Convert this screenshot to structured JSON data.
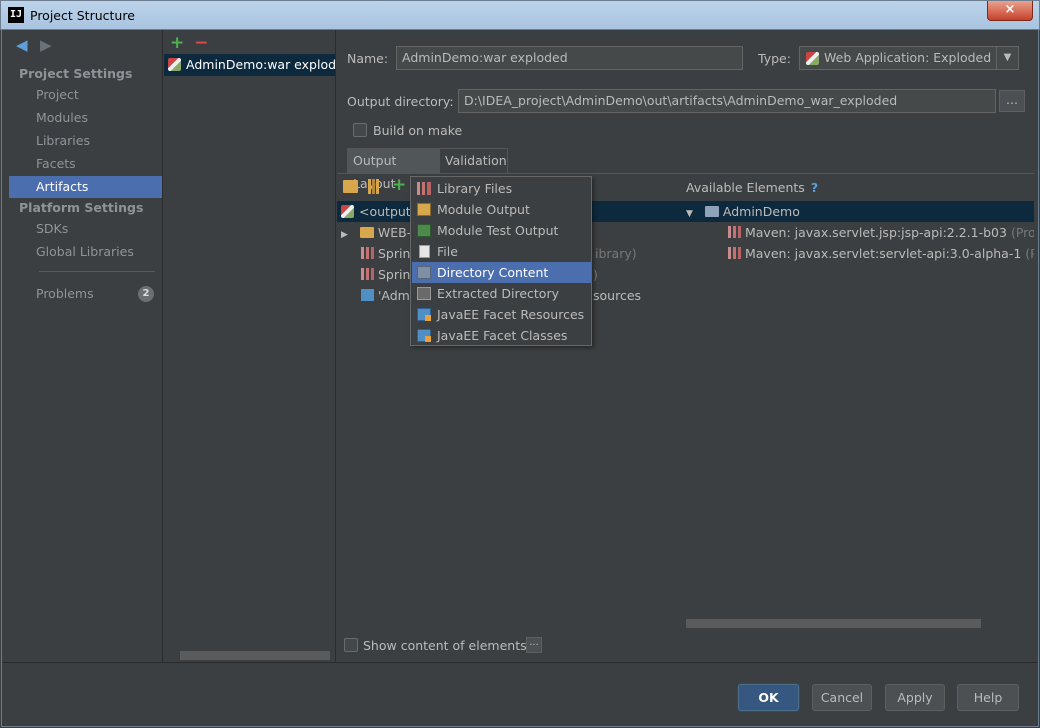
{
  "window": {
    "title": "Project Structure",
    "close_label": "×",
    "app_icon_label": "IJ"
  },
  "nav": {
    "back_icon": "◀",
    "forward_icon": "▶",
    "project_settings_header": "Project Settings",
    "project_settings_items": [
      "Project",
      "Modules",
      "Libraries",
      "Facets",
      "Artifacts"
    ],
    "selected_item": "Artifacts",
    "platform_settings_header": "Platform Settings",
    "platform_settings_items": [
      "SDKs",
      "Global Libraries"
    ],
    "problems_label": "Problems",
    "problems_count": "2"
  },
  "artifact_list": {
    "add_icon": "+",
    "remove_icon": "−",
    "items": [
      "AdminDemo:war exploded"
    ]
  },
  "form": {
    "name_label": "Name:",
    "name_value": "AdminDemo:war exploded",
    "type_label": "Type:",
    "type_value": "Web Application: Exploded",
    "output_dir_label": "Output directory:",
    "output_dir_value": "D:\\IDEA_project\\AdminDemo\\out\\artifacts\\AdminDemo_war_exploded",
    "browse_label": "...",
    "build_on_make_label": "Build on make"
  },
  "tabs": [
    "Output Layout",
    "Validation"
  ],
  "layout_tree": {
    "rows": [
      {
        "prefix": "",
        "text": "<output r",
        "suffix": ""
      },
      {
        "prefix": "▶",
        "text": "WEB-I",
        "suffix": ""
      },
      {
        "prefix": "",
        "text": "Spring",
        "suffix": "ibrary)"
      },
      {
        "prefix": "",
        "text": "Spring",
        "suffix": ")"
      },
      {
        "prefix": "",
        "text": "'Admi",
        "suffix": "sources"
      }
    ],
    "show_content_label": "Show content of elements",
    "show_content_button": "..."
  },
  "available": {
    "title": "Available Elements",
    "help_icon": "?",
    "root": "AdminDemo",
    "root_toggle": "▼",
    "items": [
      {
        "text": "Maven: javax.servlet.jsp:jsp-api:2.2.1-b03",
        "suffix": "(Project"
      },
      {
        "text": "Maven: javax.servlet:servlet-api:3.0-alpha-1",
        "suffix": "(Proje"
      }
    ]
  },
  "popup_menu": {
    "items": [
      {
        "label": "Library Files",
        "icon": "library-icon"
      },
      {
        "label": "Module Output",
        "icon": "module-output-icon"
      },
      {
        "label": "Module Test Output",
        "icon": "module-test-output-icon"
      },
      {
        "label": "File",
        "icon": "file-icon"
      },
      {
        "label": "Directory Content",
        "icon": "directory-content-icon"
      },
      {
        "label": "Extracted Directory",
        "icon": "extracted-directory-icon"
      },
      {
        "label": "JavaEE Facet Resources",
        "icon": "javaee-facet-icon"
      },
      {
        "label": "JavaEE Facet Classes",
        "icon": "javaee-facet-icon"
      }
    ],
    "highlighted": "Directory Content"
  },
  "buttons": {
    "ok": "OK",
    "cancel": "Cancel",
    "apply": "Apply",
    "help": "Help"
  },
  "colors": {
    "background": "#3c3f41",
    "selection": "#4b6eaf",
    "tree_selection": "#0d293e",
    "accent_green": "#4db24d",
    "accent_red": "#d84a4a"
  }
}
